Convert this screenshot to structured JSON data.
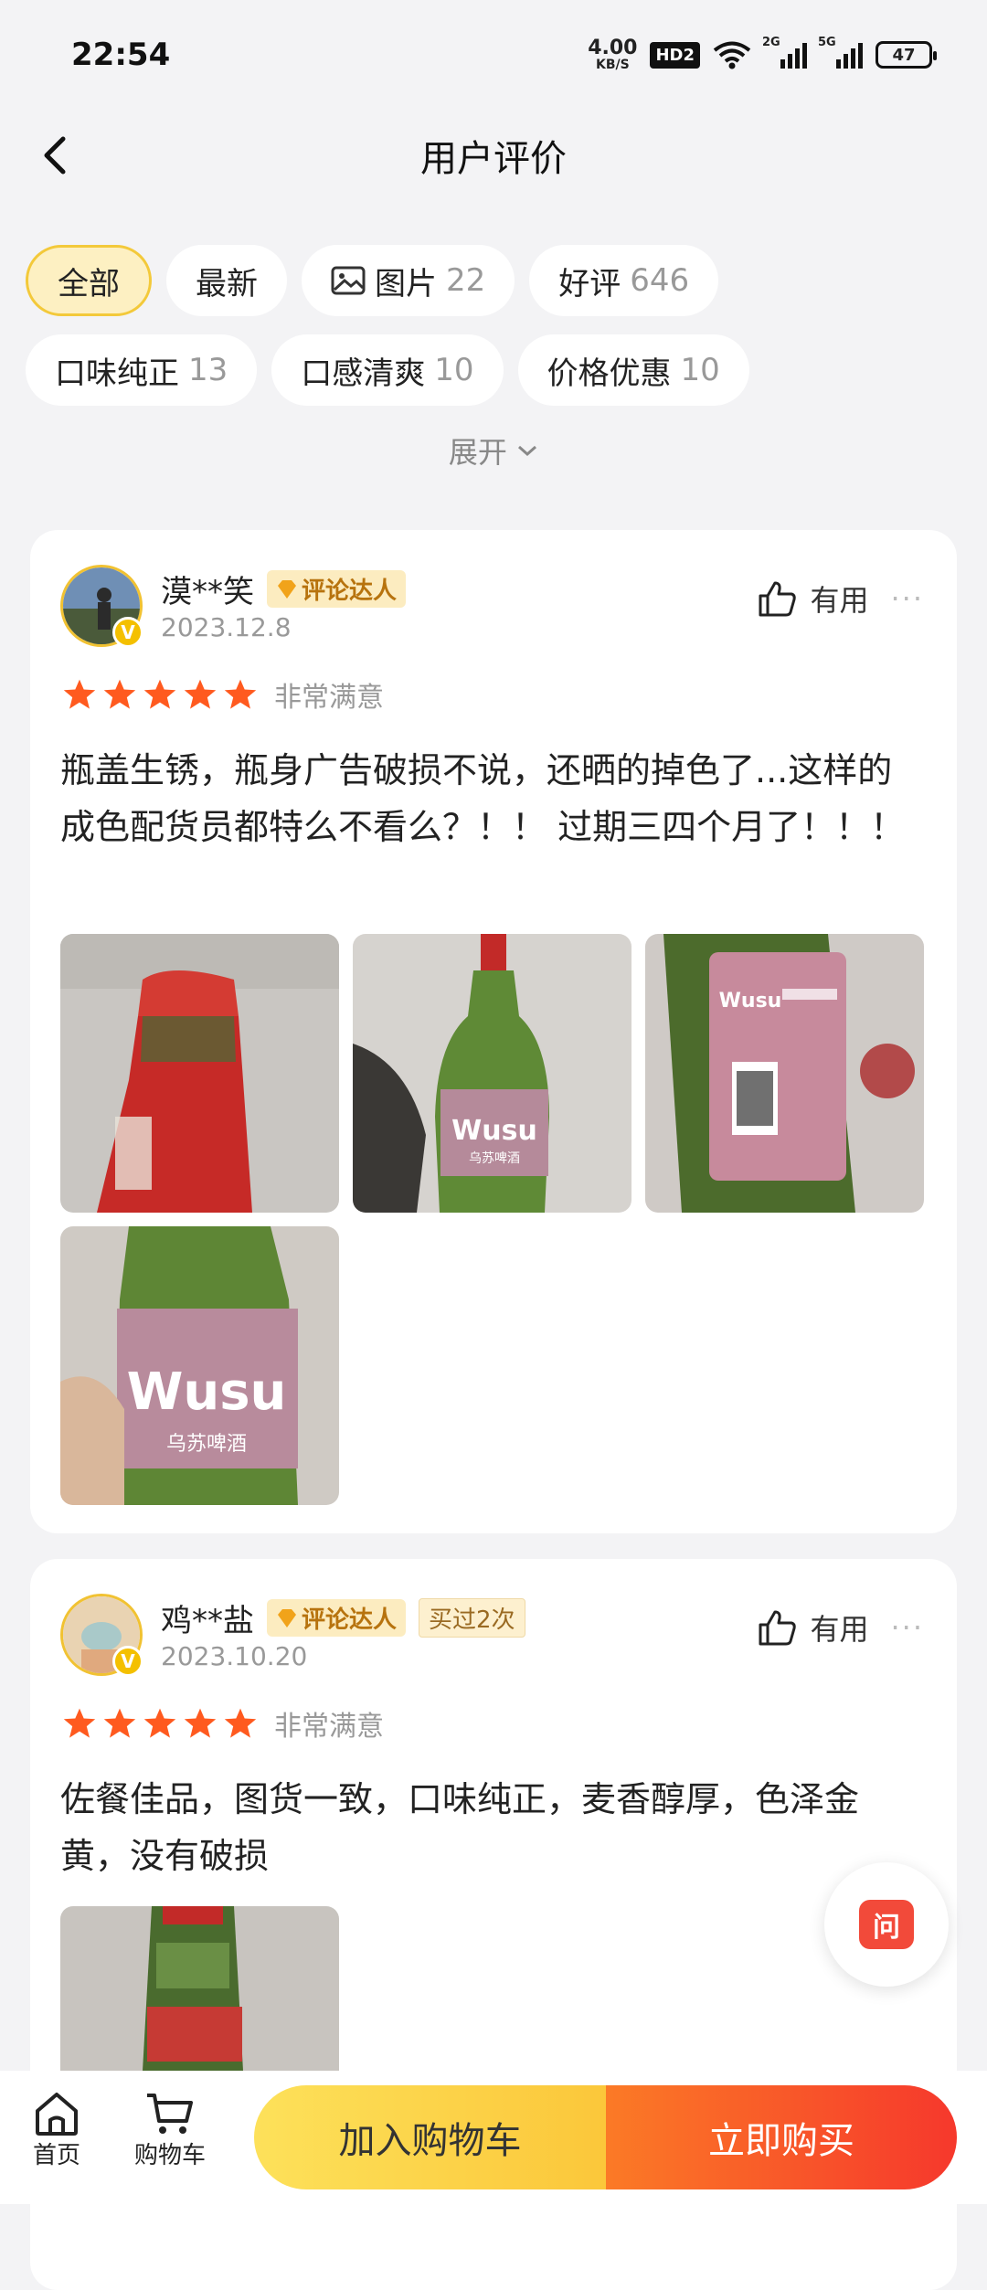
{
  "status_bar": {
    "time": "22:54",
    "net_speed": "4.00",
    "net_unit": "KB/S",
    "hd": "HD2",
    "sig1": "2G",
    "sig2": "5G",
    "battery": "47"
  },
  "header": {
    "title": "用户评价"
  },
  "filters": {
    "row1": [
      {
        "label": "全部",
        "count": ""
      },
      {
        "label": "最新",
        "count": ""
      },
      {
        "label": "图片",
        "count": "22"
      },
      {
        "label": "好评",
        "count": "646"
      }
    ],
    "row2": [
      {
        "label": "口味纯正",
        "count": "13"
      },
      {
        "label": "口感清爽",
        "count": "10"
      },
      {
        "label": "价格优惠",
        "count": "10"
      }
    ],
    "expand": "展开"
  },
  "reviews": [
    {
      "user": "漠**笑",
      "badge": "评论达人",
      "date": "2023.12.8",
      "useful": "有用",
      "rating_text": "非常满意",
      "text": "瓶盖生锈，瓶身广告破损不说，还晒的掉色了...这样的成色配货员都特么不看么？！！ 过期三四个月了！！！"
    },
    {
      "user": "鸡**盐",
      "badge": "评论达人",
      "bought": "买过2次",
      "date": "2023.10.20",
      "useful": "有用",
      "rating_text": "非常满意",
      "text": "佐餐佳品，图货一致，口味纯正，麦香醇厚，色泽金黄，没有破损"
    }
  ],
  "photo_text": {
    "brand": "Wusu",
    "sub": "乌苏啤酒"
  },
  "ask_label": "问",
  "bottom_bar": {
    "home": "首页",
    "cart": "购物车",
    "add_cart": "加入购物车",
    "buy_now": "立即购买"
  },
  "colors": {
    "accent_yellow": "#fbc73a",
    "accent_red": "#f6382c",
    "star": "#ff5a1f"
  }
}
